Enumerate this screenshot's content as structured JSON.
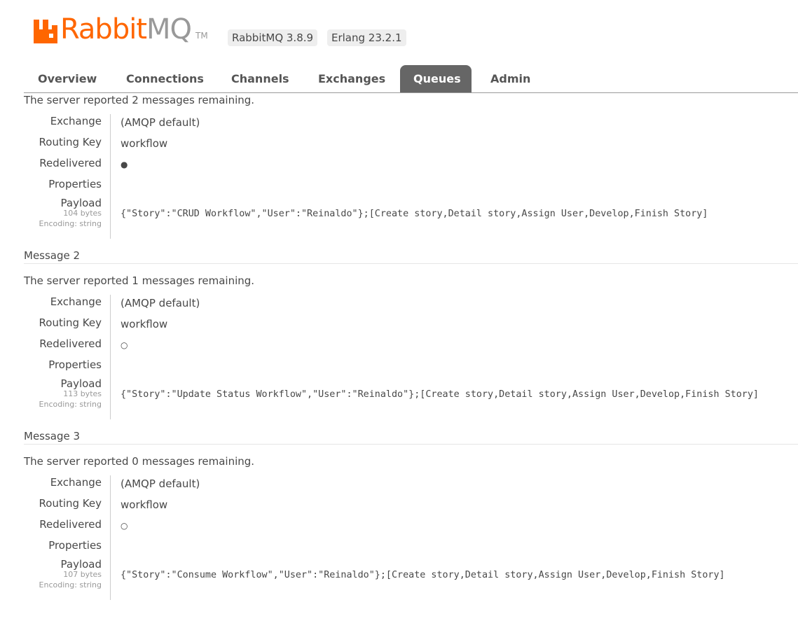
{
  "brand": {
    "name_part1": "Rabbit",
    "name_part2": "MQ",
    "trademark": "TM",
    "rabbitmq_version": "RabbitMQ 3.8.9",
    "erlang_version": "Erlang 23.2.1",
    "accent_color": "#ff6600"
  },
  "nav": {
    "tabs": [
      {
        "label": "Overview",
        "active": false
      },
      {
        "label": "Connections",
        "active": false
      },
      {
        "label": "Channels",
        "active": false
      },
      {
        "label": "Exchanges",
        "active": false
      },
      {
        "label": "Queues",
        "active": true
      },
      {
        "label": "Admin",
        "active": false
      }
    ]
  },
  "labels": {
    "exchange": "Exchange",
    "routing_key": "Routing Key",
    "redelivered": "Redelivered",
    "properties": "Properties",
    "payload": "Payload",
    "encoding": "Encoding: string"
  },
  "messages": [
    {
      "heading": "",
      "remaining_prefix": "The server reported ",
      "remaining_count": "2",
      "remaining_suffix": " messages remaining.",
      "exchange": "(AMQP default)",
      "routing_key": "workflow",
      "redelivered": "●",
      "payload_bytes": "104 bytes",
      "payload": "{\"Story\":\"CRUD Workflow\",\"User\":\"Reinaldo\"};[Create story,Detail story,Assign User,Develop,Finish Story]"
    },
    {
      "heading": "Message 2",
      "remaining_prefix": "The server reported ",
      "remaining_count": "1",
      "remaining_suffix": " messages remaining.",
      "exchange": "(AMQP default)",
      "routing_key": "workflow",
      "redelivered": "○",
      "payload_bytes": "113 bytes",
      "payload": "{\"Story\":\"Update Status Workflow\",\"User\":\"Reinaldo\"};[Create story,Detail story,Assign User,Develop,Finish Story]"
    },
    {
      "heading": "Message 3",
      "remaining_prefix": "The server reported ",
      "remaining_count": "0",
      "remaining_suffix": " messages remaining.",
      "exchange": "(AMQP default)",
      "routing_key": "workflow",
      "redelivered": "○",
      "payload_bytes": "107 bytes",
      "payload": "{\"Story\":\"Consume Workflow\",\"User\":\"Reinaldo\"};[Create story,Detail story,Assign User,Develop,Finish Story]"
    }
  ]
}
